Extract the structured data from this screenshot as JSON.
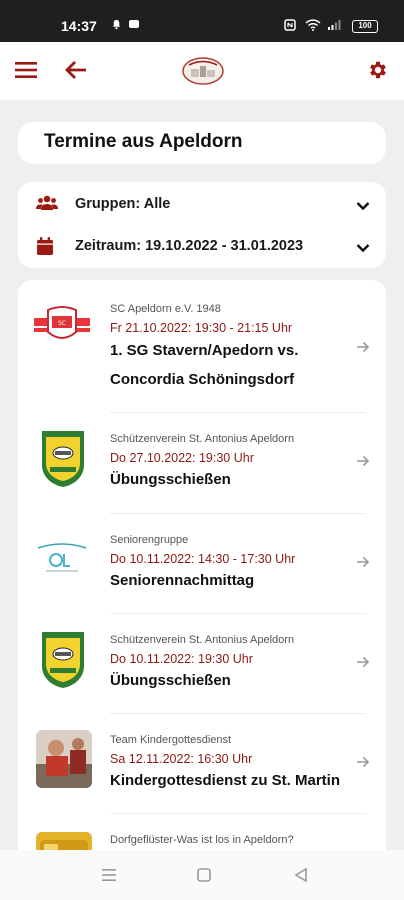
{
  "status_bar": {
    "time": "14:37",
    "battery": "100",
    "icons": [
      "notification-bell-icon",
      "message-icon",
      "nfc-icon",
      "wifi-icon",
      "signal-icon",
      "battery-icon"
    ]
  },
  "app_bar": {
    "menu_icon": "hamburger-menu-icon",
    "back_icon": "arrow-left-icon",
    "logo": "apeldorn-logo",
    "settings_icon": "gear-icon"
  },
  "page": {
    "title": "Termine aus Apeldorn"
  },
  "filters": {
    "groups_label": "Gruppen: Alle",
    "period_label": "Zeitraum: 19.10.2022 - 31.01.2023",
    "groups_icon": "users-icon",
    "period_icon": "calendar-icon"
  },
  "events": [
    {
      "organizer": "SC Apeldorn e.V. 1948",
      "date": "Fr 21.10.2022: 19:30 - 21:15 Uhr",
      "title_line1": "1. SG Stavern/Apedorn vs.",
      "title_line2": "Concordia Schöningsdorf",
      "thumb": "sc-apeldorn-crest"
    },
    {
      "organizer": "Schützenverein St. Antonius Apeldorn",
      "date": "Do 27.10.2022: 19:30 Uhr",
      "title_line1": "Übungsschießen",
      "thumb": "schuetzenverein-crest"
    },
    {
      "organizer": "Seniorengruppe",
      "date": "Do 10.11.2022: 14:30 - 17:30 Uhr",
      "title_line1": "Seniorennachmittag",
      "thumb": "seniorengruppe-logo"
    },
    {
      "organizer": "Schützenverein St. Antonius Apeldorn",
      "date": "Do 10.11.2022: 19:30 Uhr",
      "title_line1": "Übungsschießen",
      "thumb": "schuetzenverein-crest"
    },
    {
      "organizer": "Team Kindergottesdienst",
      "date": "Sa 12.11.2022: 16:30 Uhr",
      "title_line1": "Kindergottesdienst zu St. Martin",
      "thumb": "kindergottesdienst-photo"
    },
    {
      "organizer": "Dorfgeflüster-Was ist los in Apeldorn?",
      "thumb": "dorfgefluester-photo"
    }
  ],
  "colors": {
    "brand": "#9b1b12",
    "date_text": "#8b1a12",
    "background": "#efefef"
  },
  "nav_bar": {
    "recents_icon": "recents-icon",
    "home_icon": "home-icon",
    "back_icon": "back-triangle-icon"
  }
}
